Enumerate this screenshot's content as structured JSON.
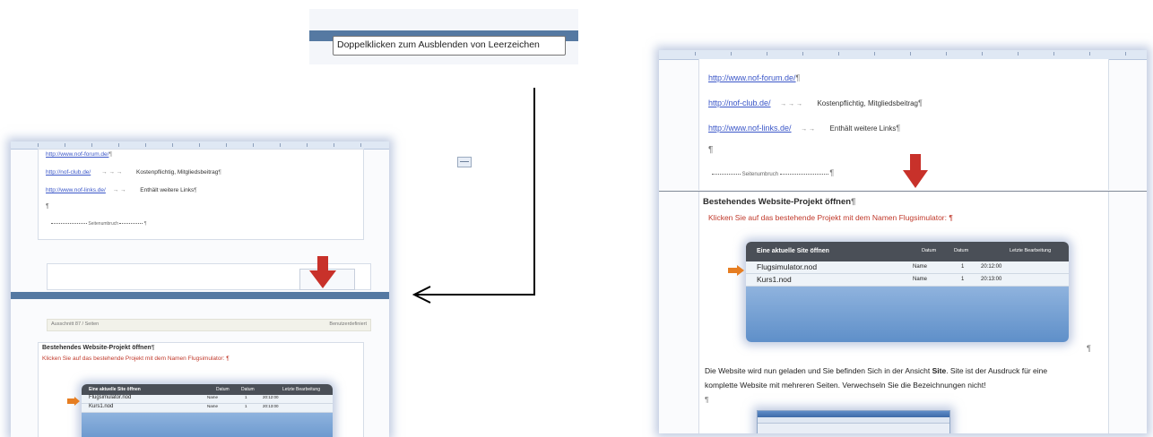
{
  "tooltip": {
    "text": "Doppelklicken zum Ausblenden von Leerzeichen"
  },
  "center_icon": "page-separator-icon",
  "doc": {
    "link1": "http://www.nof-forum.de/",
    "link2": "http://nof-club.de/",
    "link3": "http://www.nof-links.de/",
    "desc2": "Kostenpflichtig, Mitgliedsbeitrag",
    "desc3": "Enthält weitere Links",
    "pilcrow": "¶",
    "tab_arrows": "→ → →",
    "tab_arrows_short": "→ →",
    "footer": "Seitenumbruch",
    "heading": "Bestehendes Website-Projekt öffnen",
    "instruction": "Klicken Sie auf das bestehende Projekt mit dem Namen Flugsimulator:",
    "table_title": "Eine aktuelle Site öffnen",
    "table_cols": [
      "Datum",
      "Datum",
      "Letzte Bearbeitung"
    ],
    "files": [
      {
        "name": "Flugsimulator.nod",
        "type": "Name",
        "n": "1",
        "time": "20:12:00"
      },
      {
        "name": "Kurs1.nod",
        "type": "Name",
        "n": "1",
        "time": "20:13:00"
      }
    ],
    "body_text_1a": "Die Website wird nun geladen und Sie befinden Sich in der Ansicht ",
    "body_bold": "Site",
    "body_text_1b": ". Site ist der Ausdruck für eine",
    "body_text_2": "komplette Website mit mehreren Seiten. Verwechseln Sie die Bezeichnungen nicht!",
    "left_dropdown": "Ausschnitt 87 / Seiten",
    "left_dropdown_right": "Benutzerdefiniert"
  },
  "colors": {
    "link": "#3a56c8",
    "heading": "#2b2b2b",
    "instruction": "#c0392b",
    "arrow": "#c8312a",
    "bluebar": "#5579a2"
  }
}
